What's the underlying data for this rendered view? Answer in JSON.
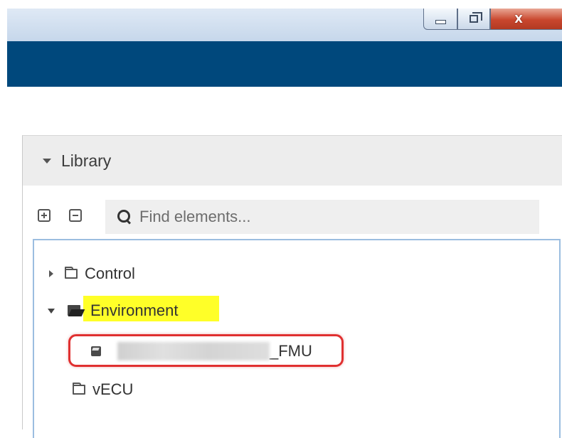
{
  "window": {
    "controls": {
      "minimize_icon": "minimize-icon",
      "maximize_icon": "restore-icon",
      "close_icon": "close-icon",
      "close_glyph": "X"
    }
  },
  "library": {
    "title": "Library",
    "toolbar": {
      "expand_icon": "plus-square-icon",
      "collapse_icon": "minus-square-icon"
    },
    "search": {
      "placeholder": "Find elements...",
      "value": ""
    },
    "tree": [
      {
        "label": "Control",
        "expanded": false,
        "icon": "folder-outline-icon"
      },
      {
        "label": "Environment",
        "expanded": true,
        "icon": "folder-open-icon",
        "highlighted": true,
        "children": [
          {
            "label": "_FMU",
            "icon": "cube-icon",
            "redacted_prefix": true,
            "selected": true
          }
        ]
      },
      {
        "label": "vECU",
        "expanded": false,
        "icon": "folder-outline-icon"
      }
    ]
  },
  "colors": {
    "header_band": "#00487c",
    "highlight": "#ffff28",
    "selection_outline": "#e03030",
    "tree_border": "#9bbde0"
  }
}
